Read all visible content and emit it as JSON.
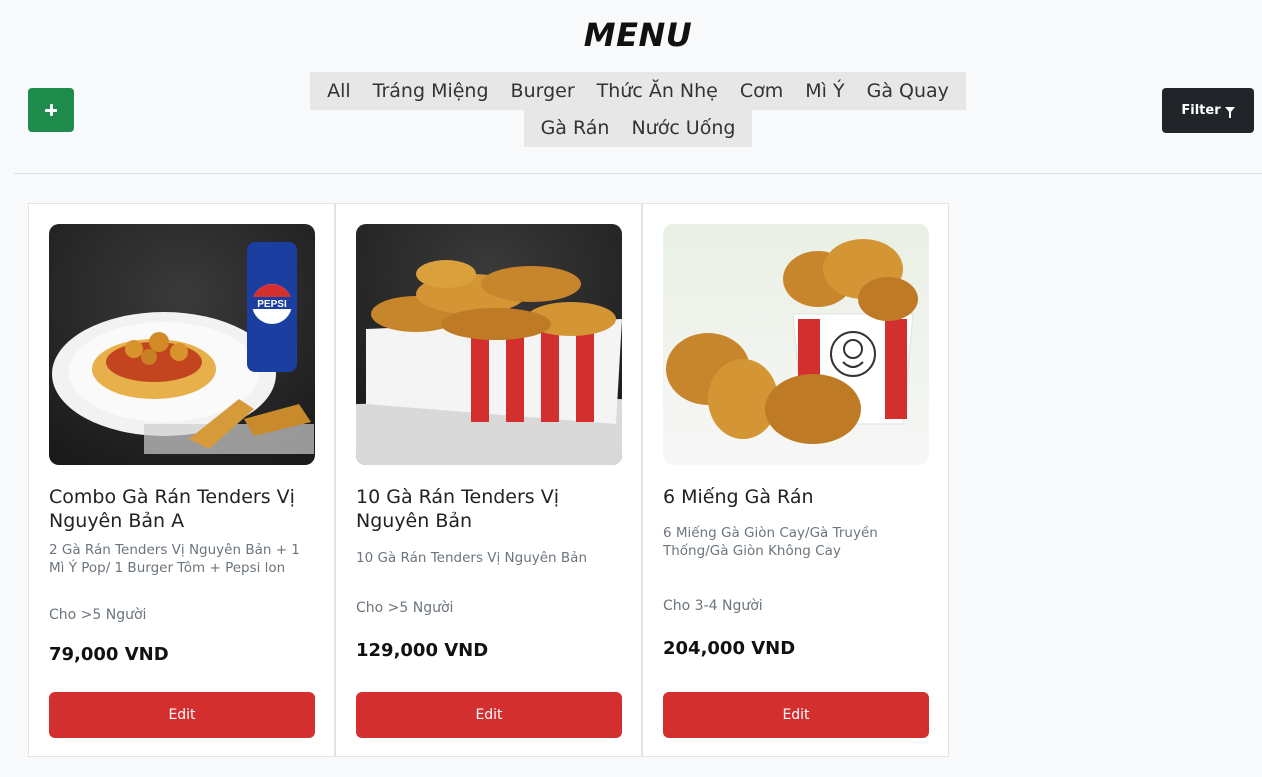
{
  "header": {
    "title": "MENU",
    "filter_label": "Filter"
  },
  "categories_row1": [
    "All",
    "Tráng Miệng",
    "Burger",
    "Thức Ăn Nhẹ",
    "Cơm",
    "Mì Ý",
    "Gà Quay"
  ],
  "categories_row2": [
    "Gà Rán",
    "Nước Uống"
  ],
  "colors": {
    "add_button": "#1e8a4c",
    "filter_button": "#212529",
    "edit_button": "#d32f2f"
  },
  "products": [
    {
      "name": "Combo Gà Rán Tenders Vị Nguyên Bản A",
      "description": "2 Gà Rán Tenders Vị Nguyên Bản + 1 Mì Ý Pop/ 1 Burger Tôm + Pepsi lon",
      "people": "Cho >5 Người",
      "price": "79,000 VND",
      "edit_label": "Edit",
      "image_brand_text": "PEPSI"
    },
    {
      "name": "10 Gà Rán Tenders Vị Nguyên Bản",
      "description": "10 Gà Rán Tenders Vị Nguyên Bản",
      "people": "Cho >5 Người",
      "price": "129,000 VND",
      "edit_label": "Edit"
    },
    {
      "name": "6 Miếng Gà Rán",
      "description": "6 Miếng Gà Giòn Cay/Gà Truyền Thống/Gà Giòn Không Cay",
      "people": "Cho 3-4 Người",
      "price": "204,000 VND",
      "edit_label": "Edit"
    }
  ]
}
